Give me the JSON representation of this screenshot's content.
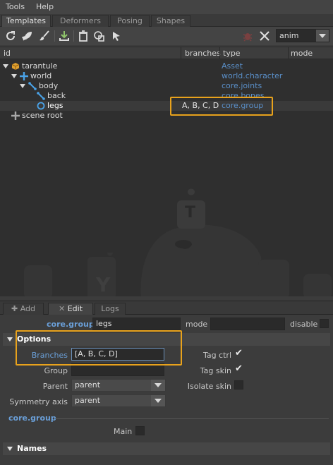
{
  "menubar": {
    "items": [
      "Tools",
      "Help"
    ]
  },
  "tabs": [
    "Templates",
    "Deformers",
    "Posing",
    "Shapes"
  ],
  "active_tab": "Templates",
  "toolbar": {
    "icons": [
      "refresh-icon",
      "rocket-icon",
      "brush-icon",
      "import-icon",
      "trash-icon",
      "duplicate-icon",
      "select-arrow-icon",
      "bug-icon",
      "tools-icon"
    ],
    "mode_select": "anim"
  },
  "tree": {
    "columns": {
      "id": "id",
      "branches": "branches",
      "type": "type",
      "mode": "mode"
    },
    "rows": [
      {
        "label": "tarantule",
        "type": "Asset",
        "branches": "",
        "icon": "asset-cube-icon"
      },
      {
        "label": "world",
        "type": "world.character",
        "branches": "",
        "icon": "world-cross-icon"
      },
      {
        "label": "body",
        "type": "core.joints",
        "branches": "",
        "icon": "joints-icon"
      },
      {
        "label": "back",
        "type": "core.bones",
        "branches": "",
        "icon": "bones-icon"
      },
      {
        "label": "legs",
        "type": "core.group",
        "branches": "A, B, C, D",
        "icon": "group-circle-icon"
      },
      {
        "label": "scene root",
        "type": "",
        "branches": "",
        "icon": "scene-cross-icon"
      }
    ],
    "watermark_letters": [
      "T",
      "Y"
    ]
  },
  "bottom_tabs": [
    "Add",
    "Edit",
    "Logs"
  ],
  "active_bottom_tab": "Edit",
  "edit": {
    "type_label": "core.group",
    "name_value": "legs",
    "mode_label": "mode",
    "mode_value": "",
    "disable_label": "disable",
    "options_section": "Options",
    "branches_label": "Branches",
    "branches_value": "[A, B, C, D]",
    "group_label": "Group",
    "group_value": "",
    "parent_label": "Parent",
    "parent_value": "parent",
    "symmetry_label": "Symmetry axis",
    "symmetry_value": "parent",
    "tag_ctrl_label": "Tag ctrl",
    "tag_ctrl_checked": true,
    "tag_skin_label": "Tag skin",
    "tag_skin_checked": true,
    "isolate_skin_label": "Isolate skin",
    "isolate_skin_checked": false,
    "core_group_title": "core.group",
    "main_label": "Main",
    "main_checked": false,
    "names_section": "Names"
  },
  "colors": {
    "accent_highlight": "#e8a21c",
    "type_link": "#5a8fc8",
    "tree_icon": "#4aa3e8"
  }
}
